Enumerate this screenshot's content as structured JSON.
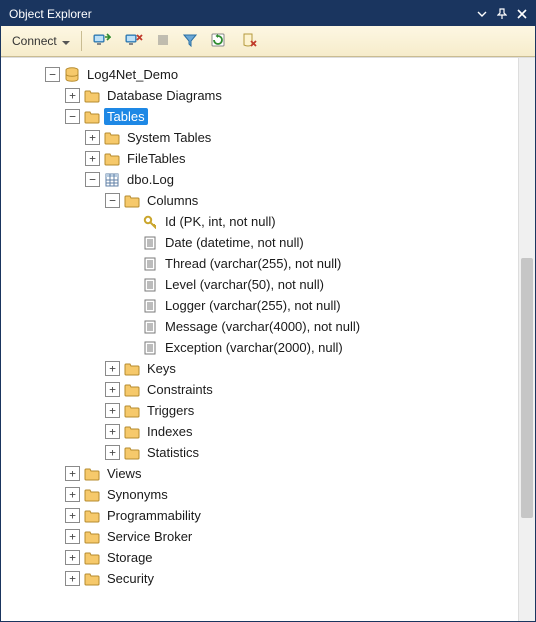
{
  "window": {
    "title": "Object Explorer"
  },
  "toolbar": {
    "connect_label": "Connect",
    "buttons": [
      "connect",
      "disconnect",
      "stop",
      "filter",
      "refresh",
      "delete"
    ]
  },
  "tree": [
    {
      "depth": 0,
      "toggle": "minus",
      "icon": "database",
      "label": "Log4Net_Demo"
    },
    {
      "depth": 1,
      "toggle": "plus",
      "icon": "folder",
      "label": "Database Diagrams"
    },
    {
      "depth": 1,
      "toggle": "minus",
      "icon": "folder",
      "label": "Tables",
      "selected": true
    },
    {
      "depth": 2,
      "toggle": "plus",
      "icon": "folder",
      "label": "System Tables"
    },
    {
      "depth": 2,
      "toggle": "plus",
      "icon": "folder",
      "label": "FileTables"
    },
    {
      "depth": 2,
      "toggle": "minus",
      "icon": "table",
      "label": "dbo.Log"
    },
    {
      "depth": 3,
      "toggle": "minus",
      "icon": "folder",
      "label": "Columns"
    },
    {
      "depth": 4,
      "toggle": "none",
      "icon": "key",
      "label": "Id (PK, int, not null)"
    },
    {
      "depth": 4,
      "toggle": "none",
      "icon": "column",
      "label": "Date (datetime, not null)"
    },
    {
      "depth": 4,
      "toggle": "none",
      "icon": "column",
      "label": "Thread (varchar(255), not null)"
    },
    {
      "depth": 4,
      "toggle": "none",
      "icon": "column",
      "label": "Level (varchar(50), not null)"
    },
    {
      "depth": 4,
      "toggle": "none",
      "icon": "column",
      "label": "Logger (varchar(255), not null)"
    },
    {
      "depth": 4,
      "toggle": "none",
      "icon": "column",
      "label": "Message (varchar(4000), not null)"
    },
    {
      "depth": 4,
      "toggle": "none",
      "icon": "column",
      "label": "Exception (varchar(2000), null)"
    },
    {
      "depth": 3,
      "toggle": "plus",
      "icon": "folder",
      "label": "Keys"
    },
    {
      "depth": 3,
      "toggle": "plus",
      "icon": "folder",
      "label": "Constraints"
    },
    {
      "depth": 3,
      "toggle": "plus",
      "icon": "folder",
      "label": "Triggers"
    },
    {
      "depth": 3,
      "toggle": "plus",
      "icon": "folder",
      "label": "Indexes"
    },
    {
      "depth": 3,
      "toggle": "plus",
      "icon": "folder",
      "label": "Statistics"
    },
    {
      "depth": 1,
      "toggle": "plus",
      "icon": "folder",
      "label": "Views"
    },
    {
      "depth": 1,
      "toggle": "plus",
      "icon": "folder",
      "label": "Synonyms"
    },
    {
      "depth": 1,
      "toggle": "plus",
      "icon": "folder",
      "label": "Programmability"
    },
    {
      "depth": 1,
      "toggle": "plus",
      "icon": "folder",
      "label": "Service Broker"
    },
    {
      "depth": 1,
      "toggle": "plus",
      "icon": "folder",
      "label": "Storage"
    },
    {
      "depth": 1,
      "toggle": "plus",
      "icon": "folder",
      "label": "Security"
    }
  ]
}
